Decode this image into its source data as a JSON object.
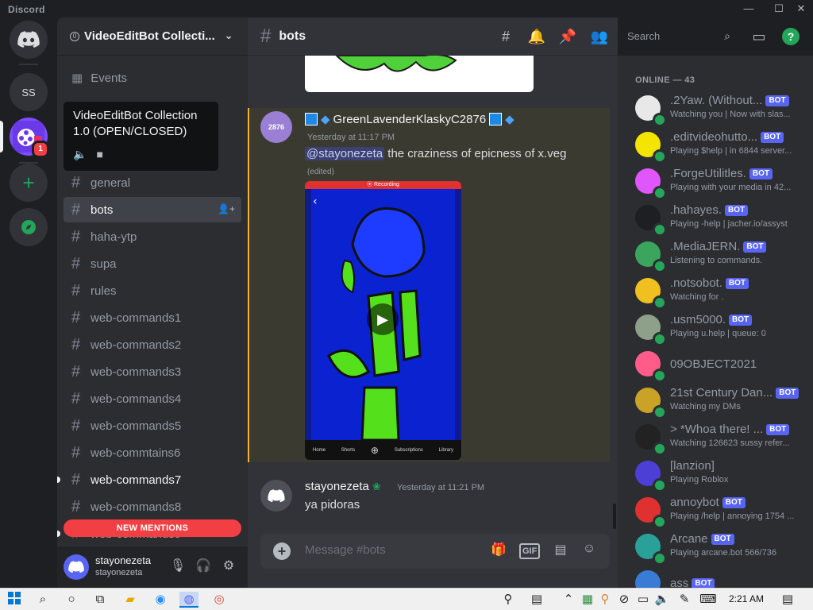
{
  "window": {
    "brand": "Discord",
    "min": "—",
    "max": "☐",
    "close": "✕"
  },
  "rail": {
    "server_initials": "SS",
    "mention_badge": "1"
  },
  "guild": {
    "name": "VideoEditBot Collecti...",
    "boost_icon": "0"
  },
  "sidebar": {
    "events_label": "Events",
    "channels": [
      "general",
      "bots",
      "haha-ytp",
      "supa",
      "rules",
      "web-commands1",
      "web-commands2",
      "web-commands3",
      "web-commands4",
      "web-commands5",
      "web-commtains6",
      "web-commands7",
      "web-commands8",
      "web-commands9"
    ],
    "new_mentions": "NEW MENTIONS"
  },
  "tooltip": {
    "title": "VideoEditBot Collection 1.0 (OPEN/CLOSED)"
  },
  "user": {
    "display_name": "stayonezeta",
    "username": "stayonezeta"
  },
  "chat": {
    "channel_name": "bots",
    "message1": {
      "author": "GreenLavenderKlaskyC2876",
      "timestamp": "Yesterday at 11:17 PM",
      "mention": "@stayonezeta",
      "text": " the craziness of epicness of x.veg",
      "edited": "(edited)",
      "avatar_text": "2876",
      "video_banner": "⦿ Recording",
      "video_nav": [
        "Home",
        "Shorts",
        "",
        "Subscriptions",
        "Library"
      ]
    },
    "message2": {
      "author": "stayonezeta",
      "timestamp": "Yesterday at 11:21 PM",
      "text": "ya pidoras"
    },
    "composer_placeholder": "Message #bots",
    "gif_label": "GIF"
  },
  "header": {
    "search_placeholder": "Search"
  },
  "members": {
    "heading": "ONLINE — 43",
    "bot_label": "BOT",
    "list": [
      {
        "name": ".2Yaw. (Without...",
        "activity": "Watching you | Now with slas...",
        "bot": true,
        "color": "#e8e8e8"
      },
      {
        "name": ".editvideohutto...",
        "activity": "Playing $help | in 6844 server...",
        "bot": true,
        "color": "#f5e400"
      },
      {
        "name": ".ForgeUtilitles.",
        "activity": "Playing with your media in 42...",
        "bot": true,
        "color": "#e056fd"
      },
      {
        "name": ".hahayes.",
        "activity": "Playing -help | jacher.io/assyst",
        "bot": true,
        "color": "#1e1f22"
      },
      {
        "name": ".MediaJERN.",
        "activity": "Listening to commands.",
        "bot": true,
        "color": "#3ba55d"
      },
      {
        "name": ".notsobot.",
        "activity": "Watching for .",
        "bot": true,
        "color": "#f0c020"
      },
      {
        "name": ".usm5000.",
        "activity": "Playing u.help | queue: 0",
        "bot": true,
        "color": "#8fa08a"
      },
      {
        "name": "09OBJECT2021",
        "activity": "",
        "bot": false,
        "color": "#ff5c8a"
      },
      {
        "name": "21st Century Dan...",
        "activity": "Watching my DMs",
        "bot": true,
        "color": "#c9a227"
      },
      {
        "name": "> *Whoa there! ...",
        "activity": "Watching 126623 sussy refer...",
        "bot": true,
        "color": "#222222"
      },
      {
        "name": "[lanzion]",
        "activity": "Playing Roblox",
        "bot": false,
        "color": "#4b3fd6"
      },
      {
        "name": "annoybot",
        "activity": "Playing /help | annoying 1754 ...",
        "bot": true,
        "color": "#e03131"
      },
      {
        "name": "Arcane",
        "activity": "Playing arcane.bot 566/736",
        "bot": true,
        "color": "#2aa198"
      },
      {
        "name": "ass",
        "activity": "",
        "bot": true,
        "color": "#3a7bd5"
      }
    ]
  },
  "taskbar": {
    "time": "2:21 AM"
  }
}
